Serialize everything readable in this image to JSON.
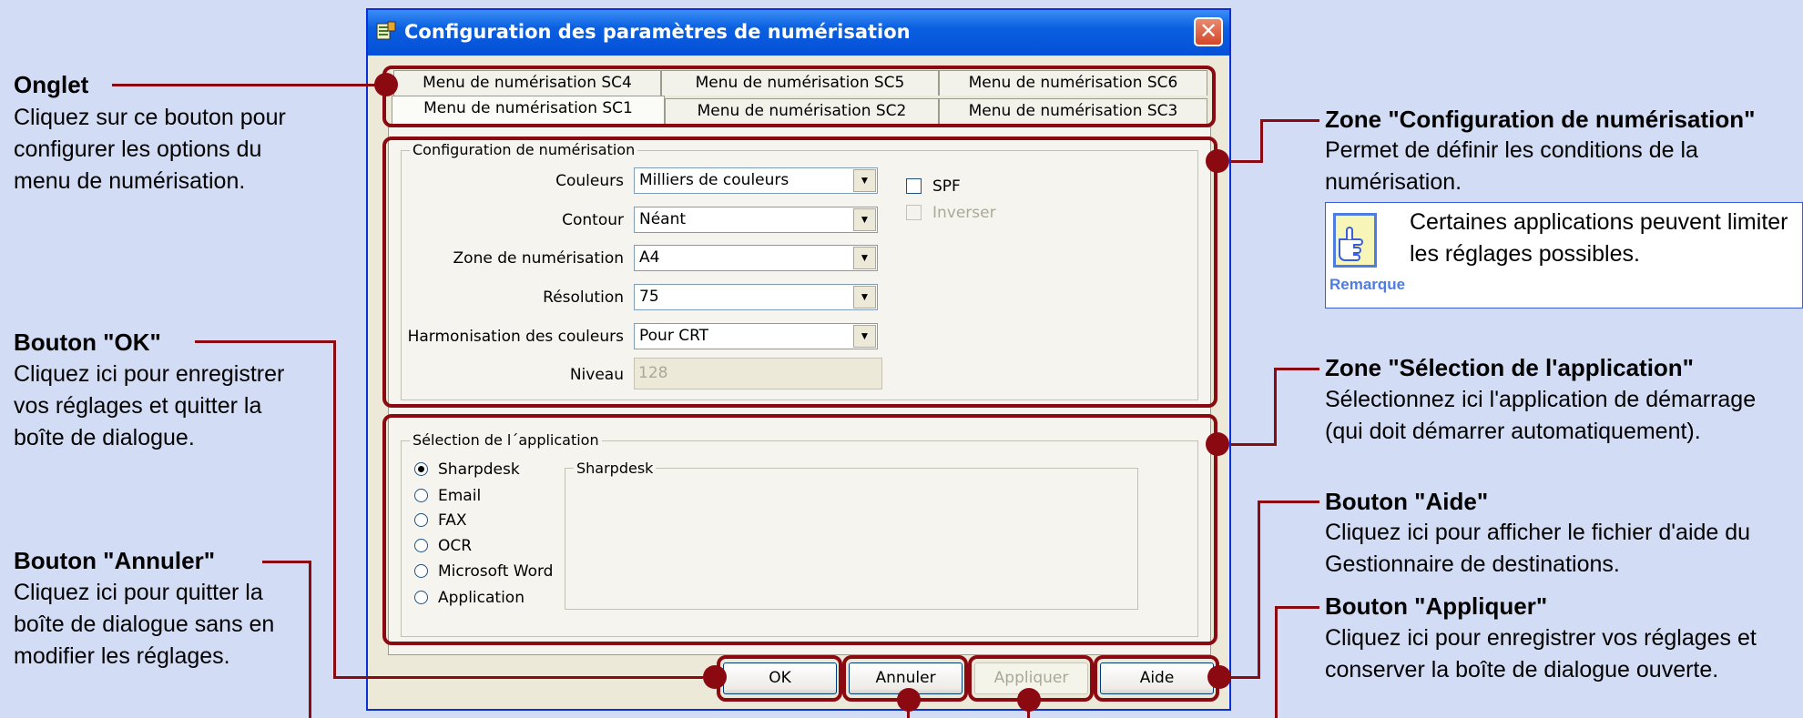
{
  "window": {
    "title": "Configuration des paramètres de numérisation",
    "close_glyph": "✕",
    "colors": {
      "titlebar": "#0a5fe0",
      "callout": "#8b0a12",
      "background": "#d2dcf4"
    }
  },
  "tabs": {
    "row1": [
      "Menu de numérisation SC4",
      "Menu de numérisation SC5",
      "Menu de numérisation SC6"
    ],
    "row2": [
      "Menu de numérisation SC1",
      "Menu de numérisation SC2",
      "Menu de numérisation SC3"
    ],
    "selected": "Menu de numérisation SC1"
  },
  "scan_config": {
    "group_label": "Configuration de numérisation",
    "fields": [
      {
        "label": "Couleurs",
        "value": "Milliers de couleurs"
      },
      {
        "label": "Contour",
        "value": "Néant"
      },
      {
        "label": "Zone de numérisation",
        "value": "A4"
      },
      {
        "label": "Résolution",
        "value": "75"
      },
      {
        "label": "Harmonisation des couleurs",
        "value": "Pour CRT"
      }
    ],
    "level": {
      "label": "Niveau",
      "value": "128"
    },
    "spf_label": "SPF",
    "invert_label": "Inverser"
  },
  "app_select": {
    "group_label": "Sélection de l´application",
    "options": [
      "Sharpdesk",
      "Email",
      "FAX",
      "OCR",
      "Microsoft Word",
      "Application"
    ],
    "selected_index": 0,
    "preview_label": "Sharpdesk"
  },
  "buttons": {
    "ok": "OK",
    "cancel": "Annuler",
    "apply": "Appliquer",
    "help": "Aide"
  },
  "callouts": {
    "tab": {
      "title": "Onglet",
      "desc": "Cliquez sur ce bouton pour configurer les options du menu de numérisation."
    },
    "ok": {
      "title": "Bouton \"OK\"",
      "desc": "Cliquez ici pour enregistrer vos réglages et quitter la boîte de dialogue."
    },
    "cancel": {
      "title": "Bouton \"Annuler\"",
      "desc": "Cliquez ici pour quitter la boîte de dialogue sans en modifier les réglages."
    },
    "scan_zone": {
      "title": "Zone \"Configuration de numérisation\"",
      "desc": "Permet de définir les conditions de la numérisation."
    },
    "note": {
      "label": "Remarque",
      "text": "Certaines applications peuvent limiter les réglages possibles."
    },
    "app_zone": {
      "title": "Zone \"Sélection de l'application\"",
      "desc": "Sélectionnez ici l'application de démarrage (qui doit démarrer automatiquement)."
    },
    "help": {
      "title": "Bouton \"Aide\"",
      "desc": "Cliquez ici pour afficher le fichier d'aide du Gestionnaire de destinations."
    },
    "apply": {
      "title": "Bouton \"Appliquer\"",
      "desc": "Cliquez ici pour enregistrer vos réglages et conserver la boîte de dialogue ouverte."
    }
  }
}
